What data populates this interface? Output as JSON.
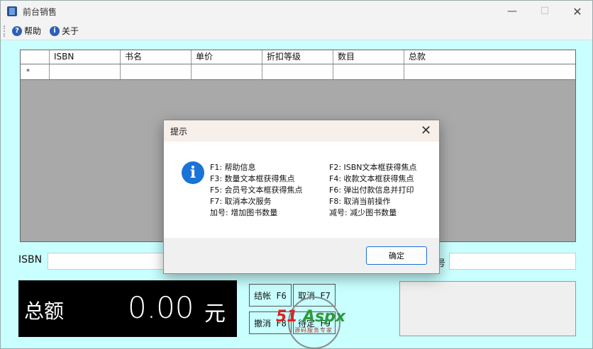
{
  "window": {
    "title": "前台销售"
  },
  "menu": {
    "help_label": "帮助",
    "about_label": "关于"
  },
  "grid": {
    "columns": [
      "",
      "ISBN",
      "书名",
      "单价",
      "折扣等级",
      "数目",
      "总款"
    ],
    "new_row_marker": "*"
  },
  "form": {
    "isbn_label": "ISBN",
    "partial_label": "号",
    "isbn_value": "",
    "right_value": ""
  },
  "total": {
    "label": "总额",
    "value": "0.00",
    "unit": "元"
  },
  "actions": {
    "checkout_label": "结帐 F6",
    "cancel_label": "取消 F7",
    "undo_label": "撤消 F8",
    "pending_label": "待定 F9"
  },
  "watermark": {
    "brand_red": "51",
    "brand_green": "Aspx",
    "subtitle": "源码服务专家"
  },
  "dialog": {
    "title": "提示",
    "left_lines": [
      "F1: 帮助信息",
      "F3: 数量文本框获得焦点",
      "F5: 会员号文本框获得焦点",
      "F7: 取消本次服务",
      "加号: 增加图书数量"
    ],
    "right_lines": [
      "F2: ISBN文本框获得焦点",
      "F4: 收款文本框获得焦点",
      "F6: 弹出付款信息并打印",
      "F8: 取消当前操作",
      "减号: 减少图书数量"
    ],
    "ok_label": "确定"
  },
  "colors": {
    "background": "#c9ffff",
    "grid_bg": "#a9a9a9",
    "total_bg": "#000000",
    "info_icon": "#1a73d6",
    "ok_border": "#1a6fd1"
  }
}
